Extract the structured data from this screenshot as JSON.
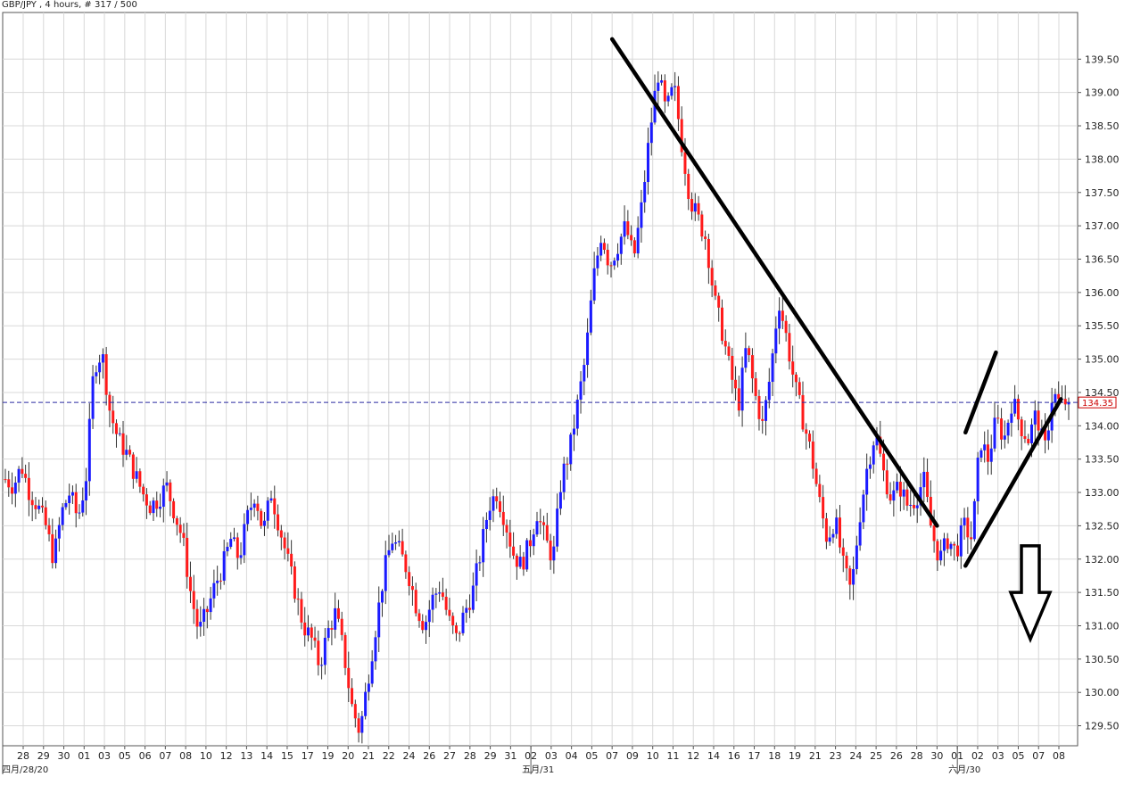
{
  "header": {
    "title": "GBP/JPY , 4 hours, # 317 / 500"
  },
  "colors": {
    "up": "#1a1aff",
    "down": "#ff1a1a",
    "grid": "#d8d8d8",
    "price_line": "#2a2aa0",
    "annotation": "#000000",
    "price_box": "#cc0000"
  },
  "chart_data": {
    "type": "candlestick",
    "symbol": "GBP/JPY",
    "timeframe": "4 hours",
    "current_price": 134.35,
    "current_price_label": "134.35",
    "ylim": [
      129.2,
      140.2
    ],
    "y_ticks": [
      "129.50",
      "130.00",
      "130.50",
      "131.00",
      "131.50",
      "132.00",
      "132.50",
      "133.00",
      "133.50",
      "134.00",
      "134.50",
      "135.00",
      "135.50",
      "136.00",
      "136.50",
      "137.00",
      "137.50",
      "138.00",
      "138.50",
      "139.00",
      "139.50"
    ],
    "x_ticks": [
      "28",
      "29",
      "30",
      "01",
      "03",
      "05",
      "06",
      "07",
      "08",
      "10",
      "12",
      "13",
      "14",
      "15",
      "17",
      "19",
      "20",
      "21",
      "22",
      "24",
      "26",
      "27",
      "28",
      "29",
      "31",
      "02",
      "03",
      "04",
      "05",
      "07",
      "09",
      "10",
      "11",
      "12",
      "14",
      "16",
      "17",
      "18",
      "19",
      "21",
      "23",
      "24",
      "25",
      "26",
      "28",
      "30",
      "01",
      "02",
      "03",
      "05",
      "07",
      "08"
    ],
    "month_labels": [
      "四月/28/20",
      "五月/31",
      "六月/30"
    ],
    "close_path": [
      133.2,
      133.1,
      133.4,
      133.0,
      132.8,
      132.5,
      132.0,
      132.7,
      133.0,
      132.6,
      133.2,
      134.9,
      135.1,
      134.2,
      133.8,
      133.6,
      133.3,
      133.0,
      132.8,
      132.9,
      133.1,
      132.7,
      132.3,
      131.5,
      130.9,
      131.2,
      131.6,
      131.9,
      132.3,
      132.0,
      132.6,
      133.0,
      132.4,
      133.0,
      132.5,
      132.0,
      131.5,
      131.0,
      130.8,
      130.4,
      130.9,
      131.2,
      130.6,
      129.8,
      129.4,
      130.2,
      131.0,
      131.8,
      132.3,
      132.1,
      131.8,
      131.3,
      131.0,
      131.4,
      131.6,
      131.1,
      130.8,
      131.2,
      131.5,
      132.1,
      132.8,
      133.0,
      132.6,
      132.1,
      131.9,
      132.2,
      132.7,
      132.3,
      132.0,
      133.2,
      133.6,
      134.3,
      135.0,
      136.2,
      136.9,
      136.4,
      136.7,
      137.0,
      136.5,
      137.3,
      138.4,
      139.3,
      138.7,
      139.1,
      138.2,
      137.4,
      137.1,
      136.8,
      135.9,
      135.4,
      134.8,
      134.3,
      135.2,
      134.5,
      134.0,
      134.8,
      135.9,
      135.3,
      134.6,
      134.1,
      133.6,
      132.9,
      132.3,
      132.6,
      131.9,
      131.5,
      132.6,
      133.4,
      133.9,
      133.3,
      132.9,
      133.1,
      132.8,
      132.9,
      133.2,
      132.4,
      132.0,
      132.3,
      132.1,
      132.5,
      132.3,
      133.8,
      133.5,
      134.1,
      133.8,
      134.4,
      134.0,
      133.8,
      134.2,
      133.6,
      134.5,
      134.3,
      134.4
    ]
  },
  "annotations": {
    "downtrend_line": {
      "from": {
        "date": "07",
        "price": 139.8
      },
      "to": {
        "date": "30",
        "price": 132.5
      }
    },
    "channel_upper": {
      "from": {
        "date": "01",
        "price": 133.9
      },
      "to": {
        "date": "03",
        "price": 135.1
      }
    },
    "channel_lower": {
      "from": {
        "date": "01",
        "price": 131.9
      },
      "to": {
        "date": "08",
        "price": 134.4
      }
    },
    "arrow": {
      "direction": "down",
      "icon": "down-arrow-icon"
    }
  }
}
